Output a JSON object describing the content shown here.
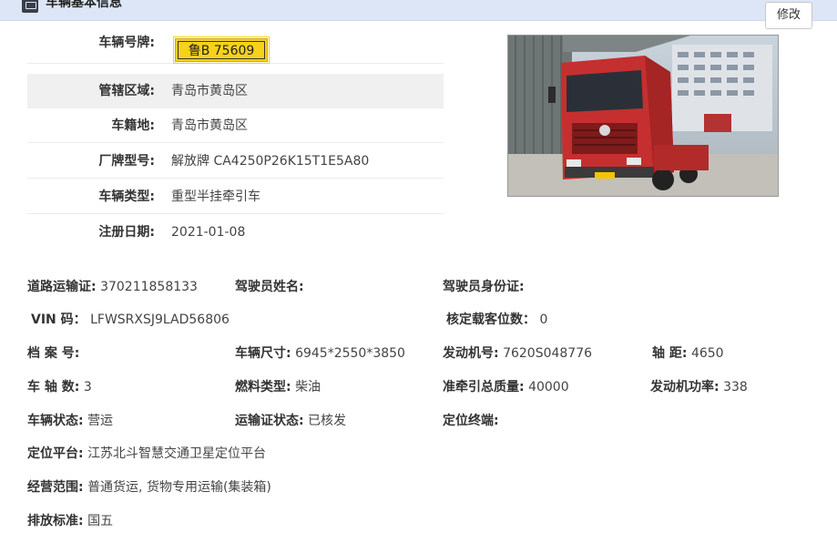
{
  "header": {
    "title": "车辆基本信息",
    "edit_label": "修改"
  },
  "plate": "鲁B 75609",
  "basic": [
    {
      "label": "车辆号牌:",
      "value": ""
    },
    {
      "label": "管辖区域:",
      "value": "青岛市黄岛区"
    },
    {
      "label": "车籍地:",
      "value": "青岛市黄岛区"
    },
    {
      "label": "厂牌型号:",
      "value": "解放牌 CA4250P26K15T1E5A80"
    },
    {
      "label": "车辆类型:",
      "value": "重型半挂牵引车"
    },
    {
      "label": "注册日期:",
      "value": "2021-01-08"
    }
  ],
  "details": {
    "road_permit": {
      "label": "道路运输证:",
      "value": "370211858133"
    },
    "driver_name": {
      "label": "驾驶员姓名:",
      "value": ""
    },
    "driver_id": {
      "label": "驾驶员身份证:",
      "value": ""
    },
    "vin": {
      "label": "VIN 码：",
      "value": "LFWSRXSJ9LAD56806"
    },
    "seats": {
      "label": "核定载客位数：",
      "value": "0"
    },
    "file_no": {
      "label": "档 案 号:",
      "value": ""
    },
    "size": {
      "label": "车辆尺寸:",
      "value": "6945*2550*3850"
    },
    "engine_no": {
      "label": "发动机号:",
      "value": "7620S048776"
    },
    "wheelbase": {
      "label": "轴 距:",
      "value": "4650"
    },
    "axles": {
      "label": "车 轴 数:",
      "value": "3"
    },
    "fuel": {
      "label": "燃料类型:",
      "value": "柴油"
    },
    "tow_mass": {
      "label": "准牵引总质量:",
      "value": "40000"
    },
    "engine_power": {
      "label": "发动机功率:",
      "value": "338"
    },
    "status": {
      "label": "车辆状态:",
      "value": "营运"
    },
    "permit_status": {
      "label": "运输证状态:",
      "value": "已核发"
    },
    "gps_terminal": {
      "label": "定位终端:",
      "value": ""
    },
    "gps_platform": {
      "label": "定位平台:",
      "value": "江苏北斗智慧交通卫星定位平台"
    },
    "scope": {
      "label": "经营范围:",
      "value": "普通货运, 货物专用运输(集装箱)"
    },
    "emission": {
      "label": "排放标准:",
      "value": "国五"
    }
  },
  "photo": {
    "icon": "truck-photo",
    "plate_text": "鲁B 75609"
  }
}
